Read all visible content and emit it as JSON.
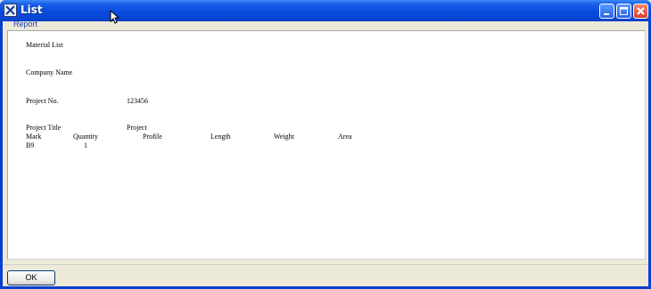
{
  "window": {
    "title": "List",
    "controls": {
      "minimize": "minimize",
      "maximize": "maximize",
      "close": "close"
    }
  },
  "menu": {
    "report_label": "Report"
  },
  "report": {
    "heading": "Material List",
    "company_name_label": "Company Name",
    "project_no_label": "Project No.",
    "project_no_value": "123456",
    "project_title_label": "Project Title",
    "project_title_value": "Project",
    "columns": [
      "Mark",
      "Quantity",
      "Profile",
      "Length",
      "Weight",
      "Area"
    ],
    "rows": [
      {
        "mark": "B9",
        "quantity": "1"
      }
    ]
  },
  "buttons": {
    "ok_label": "OK"
  },
  "icons": {
    "app": "app-icon",
    "cursor": "cursor-arrow-icon",
    "minimize": "minimize-icon",
    "maximize": "maximize-icon",
    "close": "close-icon"
  },
  "colors": {
    "titlebar": "#0a4bdc",
    "window_border": "#0a3fd0",
    "close_button": "#d6402a",
    "face": "#ece9d8"
  }
}
